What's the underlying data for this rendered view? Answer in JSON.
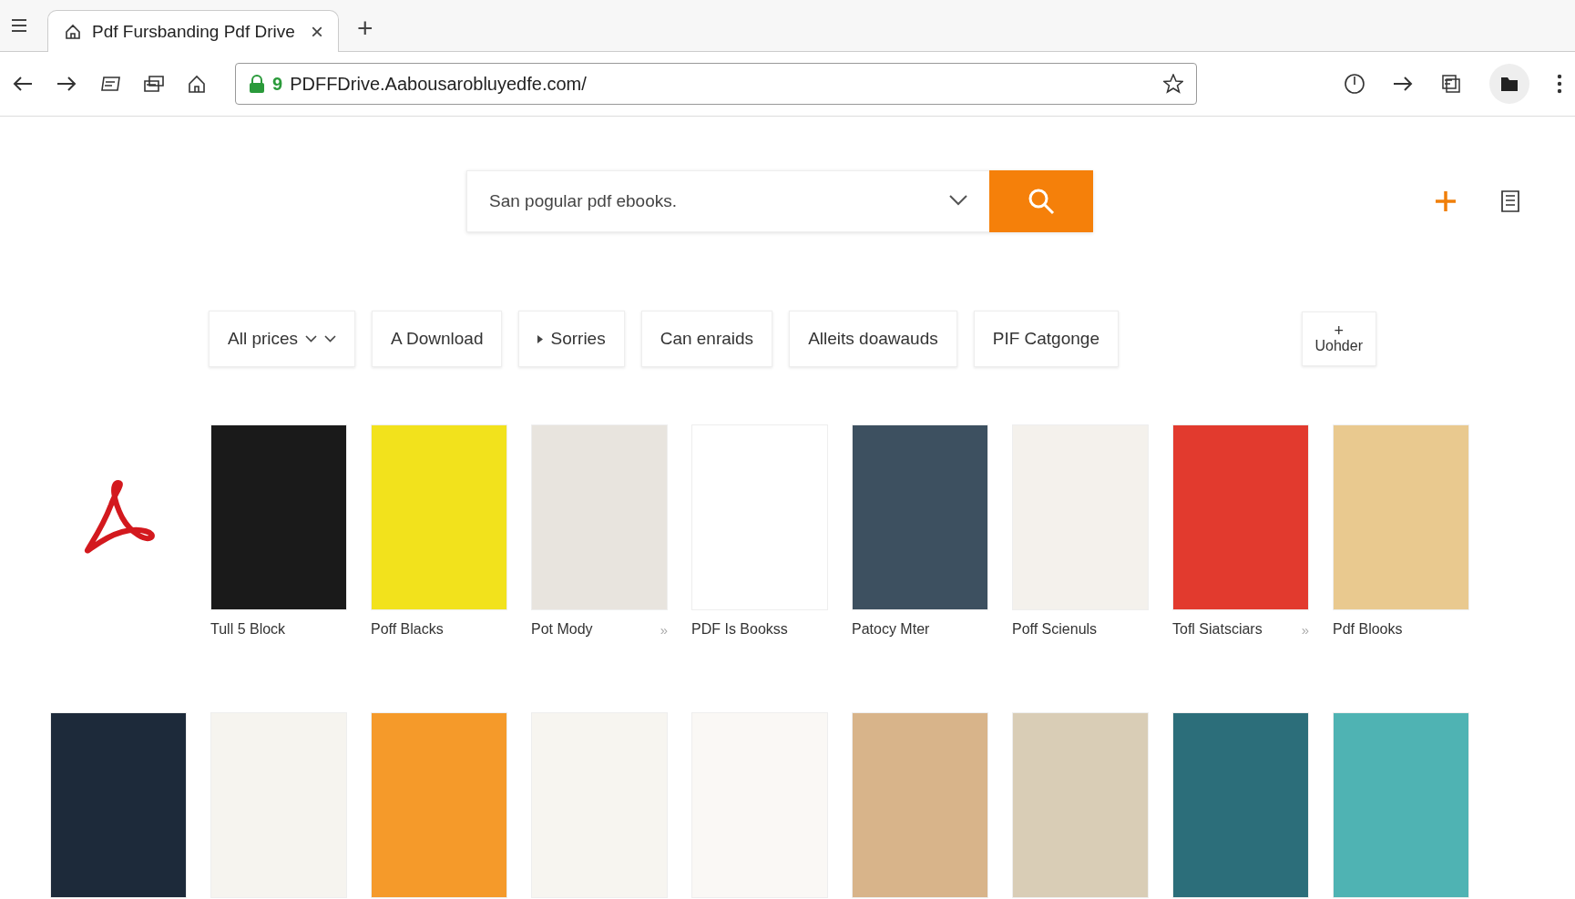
{
  "tab": {
    "title": "Pdf Fursbanding Pdf Drive",
    "close": "×",
    "new_tab": "+"
  },
  "address": {
    "url": "PDFFDrive.Aabousarobluyedfe.com/",
    "prefix": "9"
  },
  "search": {
    "placeholder": "San pogular pdf ebooks."
  },
  "filters": [
    {
      "label": "All prices",
      "kind": "dropdown"
    },
    {
      "label": "A Download",
      "kind": "plain"
    },
    {
      "label": "Sorries",
      "kind": "arrow"
    },
    {
      "label": "Can enraids",
      "kind": "plain"
    },
    {
      "label": "Alleits doawauds",
      "kind": "plain"
    },
    {
      "label": "PIF Catgonge",
      "kind": "plain"
    }
  ],
  "more_filter": {
    "icon": "+",
    "label": "Uohder"
  },
  "books_row_1": [
    {
      "title": "Tull 5 Block",
      "color": "#1a1a1a"
    },
    {
      "title": "Poff Blacks",
      "color": "#f2e21c"
    },
    {
      "title": "Pot Mody",
      "color": "#e8e4de",
      "more": "»"
    },
    {
      "title": "PDF Is Bookss",
      "color": "#ffffff"
    },
    {
      "title": "Patocy Mter",
      "color": "#3d5060"
    },
    {
      "title": "Poff Scienuls",
      "color": "#f4f1ec"
    },
    {
      "title": "Tofl Siatsciars",
      "color": "#e23a2e",
      "more": "»"
    },
    {
      "title": "Pdf Blooks",
      "color": "#e9c98f"
    }
  ],
  "books_row_2": [
    {
      "color": "#1d2a3a"
    },
    {
      "color": "#f6f4ef"
    },
    {
      "color": "#f59a2a"
    },
    {
      "color": "#f7f5f0"
    },
    {
      "color": "#faf8f5"
    },
    {
      "color": "#d8b48a"
    },
    {
      "color": "#d9cdb6"
    },
    {
      "color": "#2c6e7a"
    },
    {
      "color": "#4fb3b3"
    }
  ]
}
